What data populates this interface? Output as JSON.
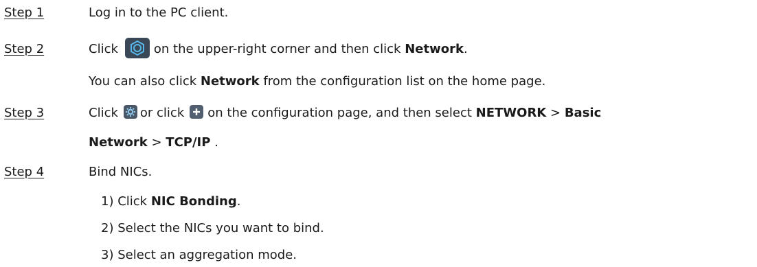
{
  "steps": [
    {
      "label": "Step 1",
      "text": "Log in to the PC client."
    },
    {
      "label": "Step 2",
      "parts": {
        "click": "Click",
        "after_icon": "on the upper-right corner and then click",
        "bold": "Network",
        "end": "."
      },
      "icon": "settings-hex-icon",
      "continuation": {
        "pre": "You can also click",
        "bold": "Network",
        "post": "from the configuration list on the home page."
      }
    },
    {
      "label": "Step 3",
      "parts": {
        "click": "Click",
        "or_click": "or click",
        "after": "on the configuration page, and then select",
        "b1": "NETWORK",
        "sep1": ">",
        "b2": "Basic",
        "b2_cont": "Network",
        "sep2": ">",
        "b3": "TCP/IP",
        "end": "."
      },
      "icons": [
        "gear-icon",
        "plus-icon"
      ]
    },
    {
      "label": "Step 4",
      "text": "Bind NICs.",
      "substeps": [
        {
          "num": "1)",
          "pre": "Click",
          "bold": "NIC Bonding",
          "post": "."
        },
        {
          "num": "2)",
          "text": "Select the NICs you want to bind."
        },
        {
          "num": "3)",
          "text": "Select an aggregation mode."
        }
      ]
    }
  ],
  "colors": {
    "text": "#1a1a1a",
    "icon_dark": "#3a4757",
    "icon_accent": "#58b7e8"
  }
}
